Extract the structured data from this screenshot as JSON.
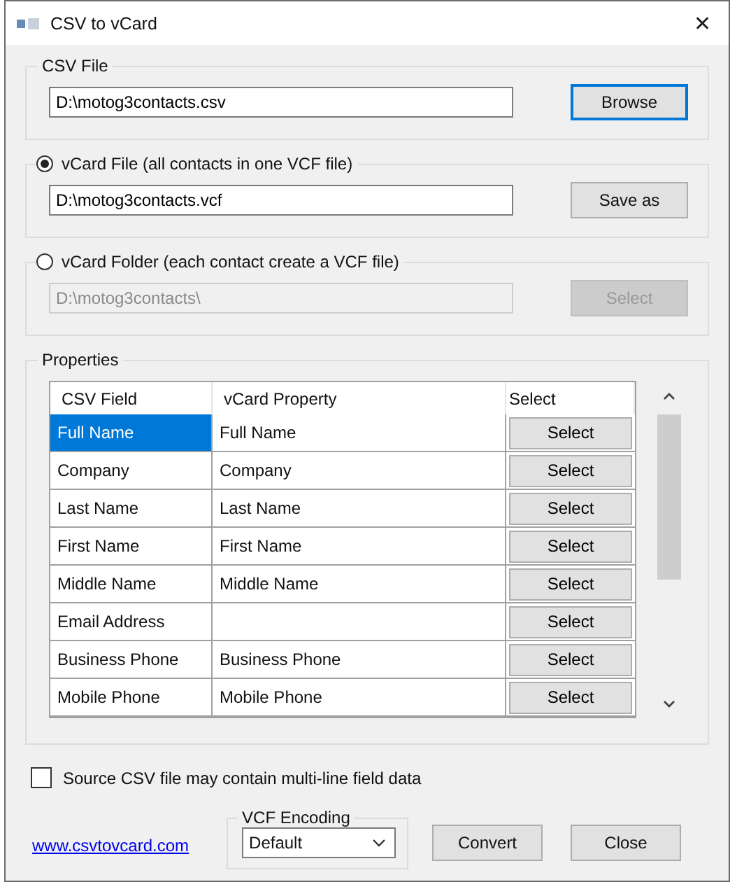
{
  "window": {
    "title": "CSV to vCard",
    "close": "✕"
  },
  "csv_file": {
    "title": "CSV File",
    "value": "D:\\motog3contacts.csv",
    "button": {
      "label": "Browse",
      "focused": true
    }
  },
  "output_options": [
    {
      "label": "vCard File (all contacts in one VCF file)",
      "selected": true,
      "value": "D:\\motog3contacts.vcf",
      "button": "Save as"
    },
    {
      "label": "vCard Folder (each contact create a VCF file)",
      "selected": false,
      "value": "D:\\motog3contacts\\",
      "button": "Select"
    }
  ],
  "properties": {
    "title": "Properties",
    "columns": [
      "CSV Field",
      "vCard Property",
      "Select"
    ],
    "rows": [
      {
        "csv_field": "Full Name",
        "vcard_property": "Full Name",
        "button": "Select",
        "selected": true
      },
      {
        "csv_field": "Company",
        "vcard_property": "Company",
        "button": "Select",
        "selected": false
      },
      {
        "csv_field": "Last Name",
        "vcard_property": "Last Name",
        "button": "Select",
        "selected": false
      },
      {
        "csv_field": "First Name",
        "vcard_property": "First Name",
        "button": "Select",
        "selected": false
      },
      {
        "csv_field": "Middle Name",
        "vcard_property": "Middle Name",
        "button": "Select",
        "selected": false
      },
      {
        "csv_field": "Email Address",
        "button": "Select",
        "selected": false
      },
      {
        "csv_field": "Business Phone",
        "vcard_property": "Business Phone",
        "button": "Select",
        "selected": false
      },
      {
        "csv_field": "Mobile Phone",
        "vcard_property": "Mobile Phone",
        "button": "Select",
        "selected": false
      }
    ]
  },
  "multiline": {
    "label": "Source CSV file may contain multi-line field data",
    "checked": false
  },
  "link": "www.csvtovcard.com",
  "encoding": {
    "title": "VCF Encoding",
    "value": "Default"
  },
  "buttons": [
    "Convert",
    "Close"
  ]
}
